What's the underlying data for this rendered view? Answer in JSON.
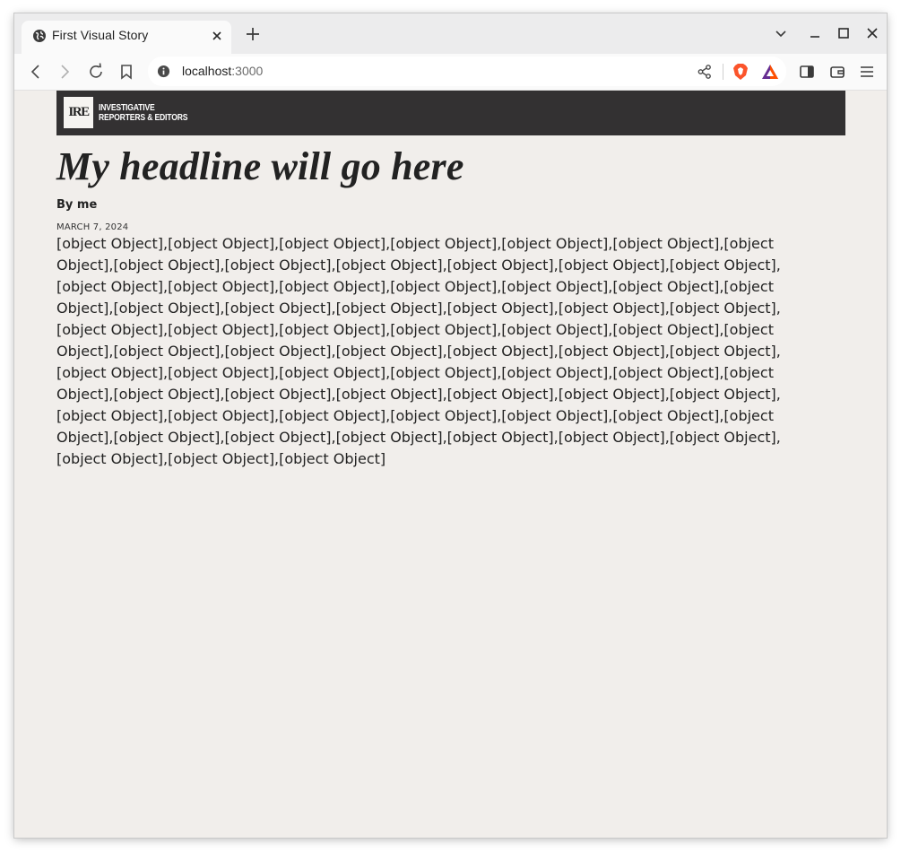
{
  "browser": {
    "tab": {
      "title": "First Visual Story",
      "favicon": "globe-icon"
    },
    "address": {
      "host": "localhost",
      "port": ":3000"
    },
    "icons": {
      "back": "back-arrow-icon",
      "forward": "forward-arrow-icon",
      "reload": "reload-icon",
      "bookmark": "bookmark-icon",
      "share": "share-icon",
      "brave": "brave-shields-icon",
      "rewards": "brave-rewards-icon",
      "sidebar": "sidebar-icon",
      "wallet": "wallet-icon",
      "menu": "hamburger-menu-icon"
    }
  },
  "page": {
    "logo": {
      "mark": "IRE",
      "line1": "INVESTIGATIVE",
      "line2": "REPORTERS & EDITORS"
    },
    "headline": "My headline will go here",
    "byline": "By me",
    "date": "MARCH 7, 2024",
    "body": "[object Object],[object Object],[object Object],[object Object],[object Object],[object Object],[object Object],[object Object],[object Object],[object Object],[object Object],[object Object],[object Object],[object Object],[object Object],[object Object],[object Object],[object Object],[object Object],[object Object],[object Object],[object Object],[object Object],[object Object],[object Object],[object Object],[object Object],[object Object],[object Object],[object Object],[object Object],[object Object],[object Object],[object Object],[object Object],[object Object],[object Object],[object Object],[object Object],[object Object],[object Object],[object Object],[object Object],[object Object],[object Object],[object Object],[object Object],[object Object],[object Object],[object Object],[object Object],[object Object],[object Object],[object Object],[object Object],[object Object],[object Object],[object Object],[object Object],[object Object],[object Object],[object Object],[object Object],[object Object],[object Object],[object Object],[object Object],[object Object]"
  },
  "colors": {
    "page_bg": "#f1eeeb",
    "header_bar": "#333132",
    "text": "#222222",
    "brave_orange": "#fb542b"
  }
}
